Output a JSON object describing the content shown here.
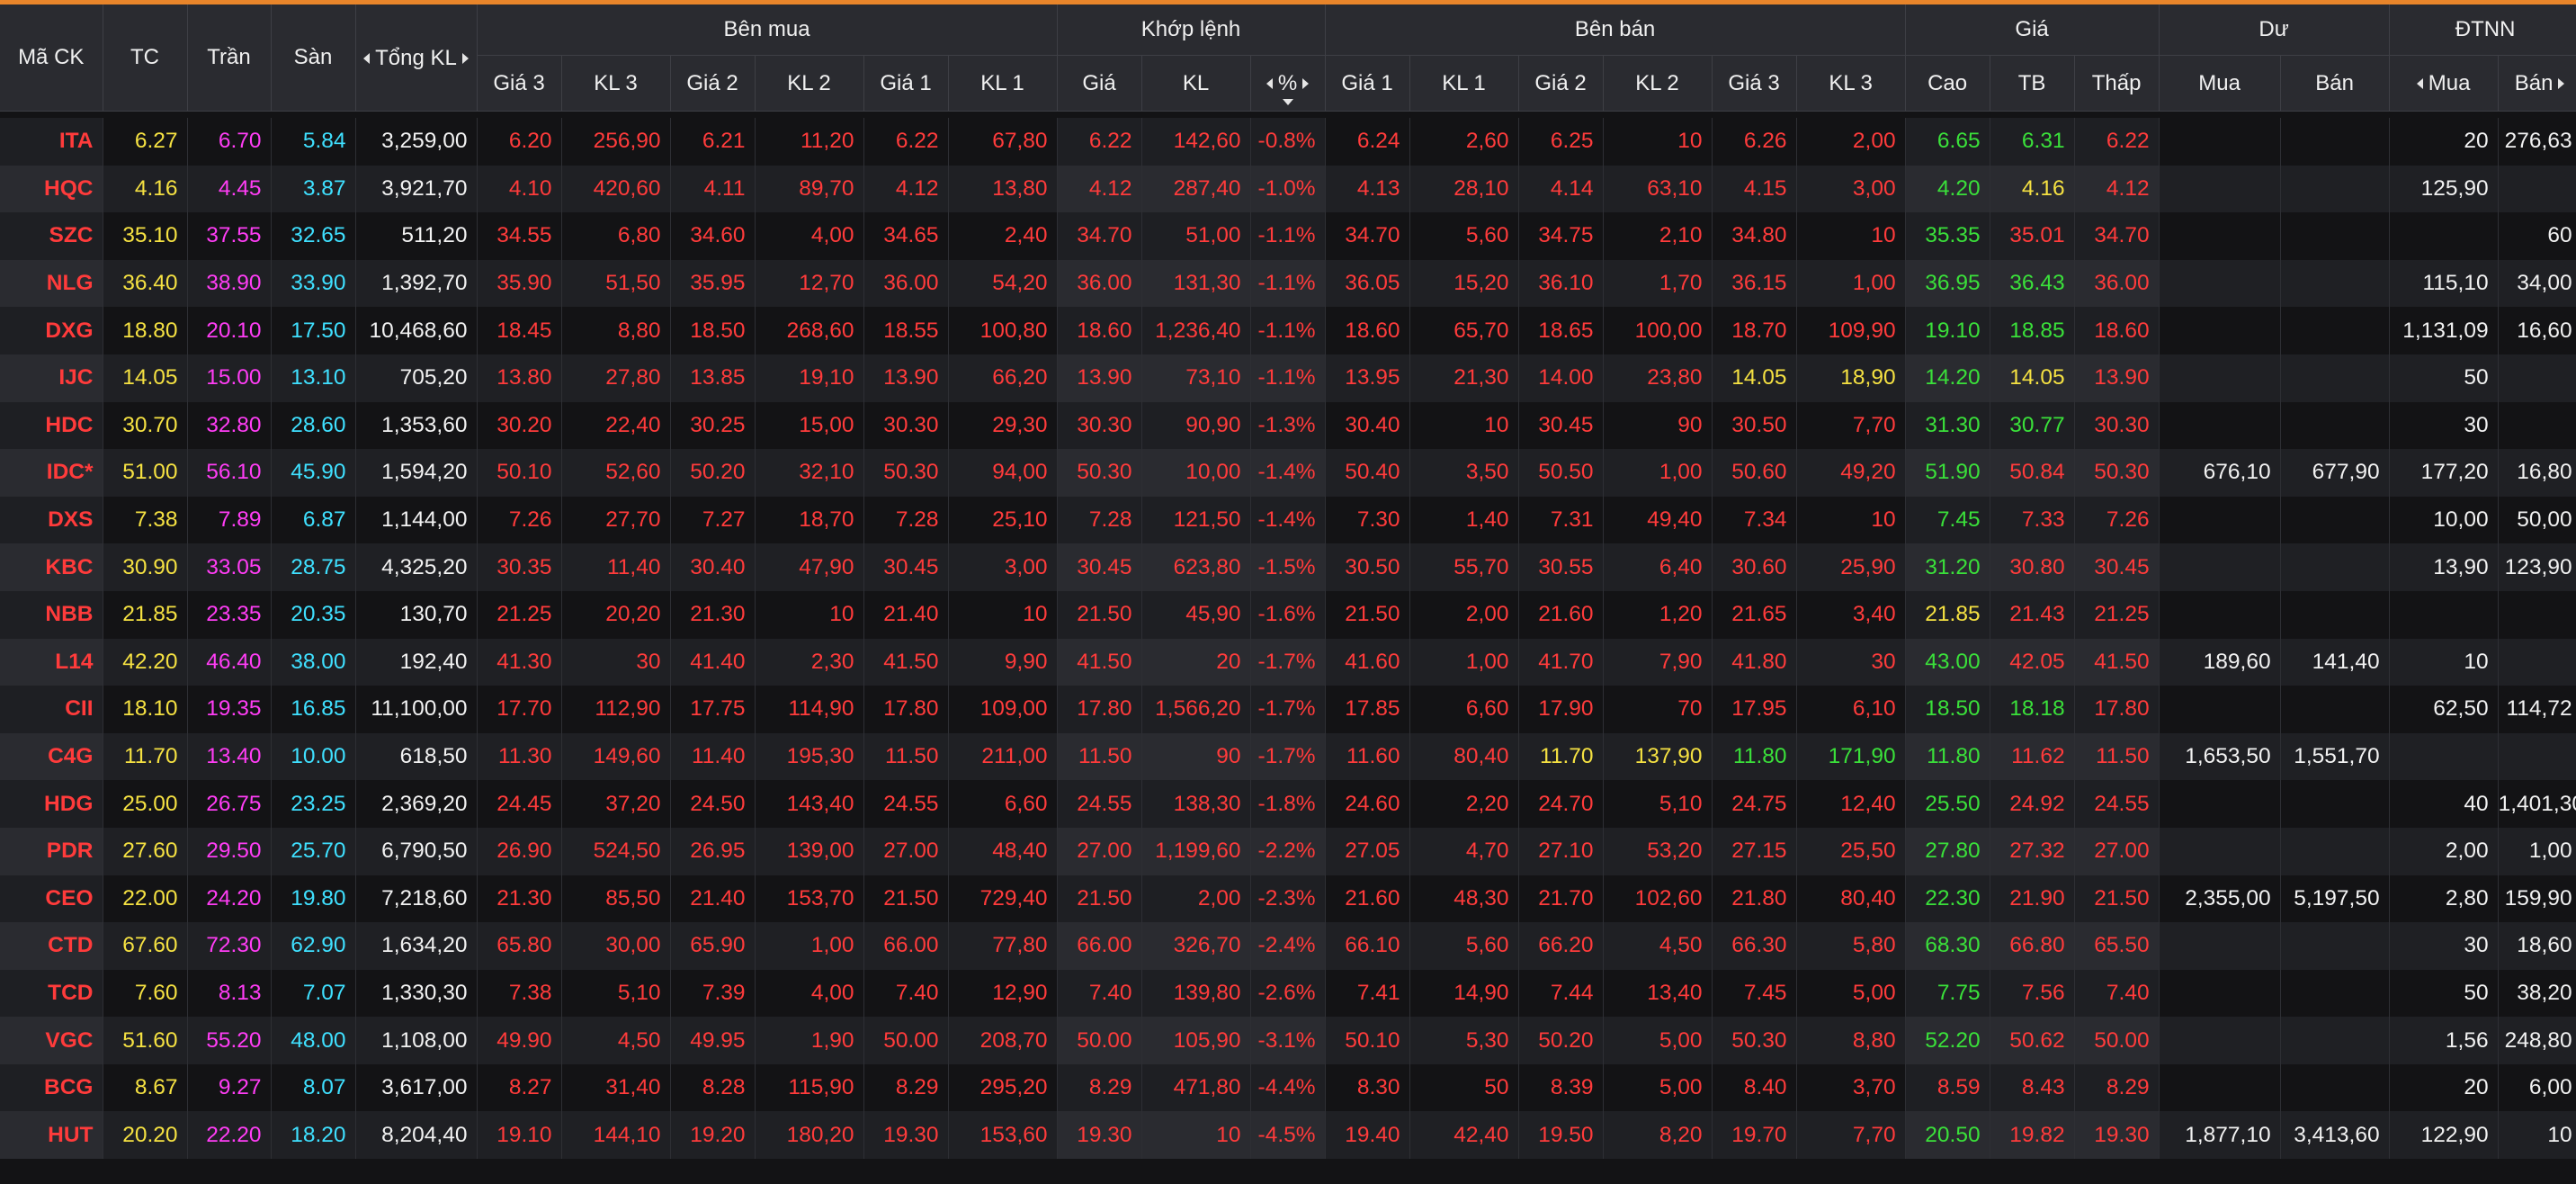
{
  "headers": {
    "symbol": "Mã CK",
    "ref": "TC",
    "ceil": "Trần",
    "floor": "Sàn",
    "total_vol": "Tổng KL",
    "buy_side": "Bên mua",
    "matched": "Khớp lệnh",
    "sell_side": "Bên bán",
    "price": "Giá",
    "surplus": "Dư",
    "foreign": "ĐTNN",
    "buy_sub": [
      "Giá 3",
      "KL 3",
      "Giá 2",
      "KL 2",
      "Giá 1",
      "KL 1"
    ],
    "match_sub": [
      "Giá",
      "KL",
      "%"
    ],
    "sell_sub": [
      "Giá 1",
      "KL 1",
      "Giá 2",
      "KL 2",
      "Giá 3",
      "KL 3"
    ],
    "price_sub": [
      "Cao",
      "TB",
      "Thấp"
    ],
    "surplus_sub": [
      "Mua",
      "Bán"
    ],
    "foreign_sub": [
      "Mua",
      "Bán"
    ]
  },
  "colors": {
    "accent_bar": "#e8852a",
    "red": "#ff3b3b",
    "yellow": "#f5e142",
    "purple": "#ff3df5",
    "cyan": "#3fe0ff",
    "green": "#3ae03a",
    "white": "#f2f2f2"
  },
  "rows": [
    {
      "cells": [
        "ITA",
        "6.27",
        "6.70",
        "5.84",
        "3,259,00",
        "6.20",
        "256,90",
        "6.21",
        "11,20",
        "6.22",
        "67,80",
        "6.22",
        "142,60",
        "-0.8%",
        "6.24",
        "2,60",
        "6.25",
        "10",
        "6.26",
        "2,00",
        "6.65",
        "6.31",
        "6.22",
        "",
        "",
        "20",
        "276,63"
      ],
      "colors": [
        "r",
        "y",
        "p",
        "c",
        "w",
        "r",
        "r",
        "r",
        "r",
        "r",
        "r",
        "r",
        "r",
        "r",
        "r",
        "r",
        "r",
        "r",
        "r",
        "r",
        "g",
        "g",
        "r",
        "w",
        "w",
        "w",
        "w"
      ]
    },
    {
      "cells": [
        "HQC",
        "4.16",
        "4.45",
        "3.87",
        "3,921,70",
        "4.10",
        "420,60",
        "4.11",
        "89,70",
        "4.12",
        "13,80",
        "4.12",
        "287,40",
        "-1.0%",
        "4.13",
        "28,10",
        "4.14",
        "63,10",
        "4.15",
        "3,00",
        "4.20",
        "4.16",
        "4.12",
        "",
        "",
        "125,90",
        ""
      ],
      "colors": [
        "r",
        "y",
        "p",
        "c",
        "w",
        "r",
        "r",
        "r",
        "r",
        "r",
        "r",
        "r",
        "r",
        "r",
        "r",
        "r",
        "r",
        "r",
        "r",
        "r",
        "g",
        "y",
        "r",
        "w",
        "w",
        "w",
        "w"
      ]
    },
    {
      "cells": [
        "SZC",
        "35.10",
        "37.55",
        "32.65",
        "511,20",
        "34.55",
        "6,80",
        "34.60",
        "4,00",
        "34.65",
        "2,40",
        "34.70",
        "51,00",
        "-1.1%",
        "34.70",
        "5,60",
        "34.75",
        "2,10",
        "34.80",
        "10",
        "35.35",
        "35.01",
        "34.70",
        "",
        "",
        "",
        "60"
      ],
      "colors": [
        "r",
        "y",
        "p",
        "c",
        "w",
        "r",
        "r",
        "r",
        "r",
        "r",
        "r",
        "r",
        "r",
        "r",
        "r",
        "r",
        "r",
        "r",
        "r",
        "r",
        "g",
        "r",
        "r",
        "w",
        "w",
        "w",
        "w"
      ]
    },
    {
      "cells": [
        "NLG",
        "36.40",
        "38.90",
        "33.90",
        "1,392,70",
        "35.90",
        "51,50",
        "35.95",
        "12,70",
        "36.00",
        "54,20",
        "36.00",
        "131,30",
        "-1.1%",
        "36.05",
        "15,20",
        "36.10",
        "1,70",
        "36.15",
        "1,00",
        "36.95",
        "36.43",
        "36.00",
        "",
        "",
        "115,10",
        "34,00"
      ],
      "colors": [
        "r",
        "y",
        "p",
        "c",
        "w",
        "r",
        "r",
        "r",
        "r",
        "r",
        "r",
        "r",
        "r",
        "r",
        "r",
        "r",
        "r",
        "r",
        "r",
        "r",
        "g",
        "g",
        "r",
        "w",
        "w",
        "w",
        "w"
      ]
    },
    {
      "cells": [
        "DXG",
        "18.80",
        "20.10",
        "17.50",
        "10,468,60",
        "18.45",
        "8,80",
        "18.50",
        "268,60",
        "18.55",
        "100,80",
        "18.60",
        "1,236,40",
        "-1.1%",
        "18.60",
        "65,70",
        "18.65",
        "100,00",
        "18.70",
        "109,90",
        "19.10",
        "18.85",
        "18.60",
        "",
        "",
        "1,131,09",
        "16,60"
      ],
      "colors": [
        "r",
        "y",
        "p",
        "c",
        "w",
        "r",
        "r",
        "r",
        "r",
        "r",
        "r",
        "r",
        "r",
        "r",
        "r",
        "r",
        "r",
        "r",
        "r",
        "r",
        "g",
        "g",
        "r",
        "w",
        "w",
        "w",
        "w"
      ]
    },
    {
      "cells": [
        "IJC",
        "14.05",
        "15.00",
        "13.10",
        "705,20",
        "13.80",
        "27,80",
        "13.85",
        "19,10",
        "13.90",
        "66,20",
        "13.90",
        "73,10",
        "-1.1%",
        "13.95",
        "21,30",
        "14.00",
        "23,80",
        "14.05",
        "18,90",
        "14.20",
        "14.05",
        "13.90",
        "",
        "",
        "50",
        ""
      ],
      "colors": [
        "r",
        "y",
        "p",
        "c",
        "w",
        "r",
        "r",
        "r",
        "r",
        "r",
        "r",
        "r",
        "r",
        "r",
        "r",
        "r",
        "r",
        "r",
        "y",
        "y",
        "g",
        "y",
        "r",
        "w",
        "w",
        "w",
        "w"
      ]
    },
    {
      "cells": [
        "HDC",
        "30.70",
        "32.80",
        "28.60",
        "1,353,60",
        "30.20",
        "22,40",
        "30.25",
        "15,00",
        "30.30",
        "29,30",
        "30.30",
        "90,90",
        "-1.3%",
        "30.40",
        "10",
        "30.45",
        "90",
        "30.50",
        "7,70",
        "31.30",
        "30.77",
        "30.30",
        "",
        "",
        "30",
        ""
      ],
      "colors": [
        "r",
        "y",
        "p",
        "c",
        "w",
        "r",
        "r",
        "r",
        "r",
        "r",
        "r",
        "r",
        "r",
        "r",
        "r",
        "r",
        "r",
        "r",
        "r",
        "r",
        "g",
        "g",
        "r",
        "w",
        "w",
        "w",
        "w"
      ]
    },
    {
      "cells": [
        "IDC*",
        "51.00",
        "56.10",
        "45.90",
        "1,594,20",
        "50.10",
        "52,60",
        "50.20",
        "32,10",
        "50.30",
        "94,00",
        "50.30",
        "10,00",
        "-1.4%",
        "50.40",
        "3,50",
        "50.50",
        "1,00",
        "50.60",
        "49,20",
        "51.90",
        "50.84",
        "50.30",
        "676,10",
        "677,90",
        "177,20",
        "16,80"
      ],
      "colors": [
        "r",
        "y",
        "p",
        "c",
        "w",
        "r",
        "r",
        "r",
        "r",
        "r",
        "r",
        "r",
        "r",
        "r",
        "r",
        "r",
        "r",
        "r",
        "r",
        "r",
        "g",
        "r",
        "r",
        "w",
        "w",
        "w",
        "w"
      ]
    },
    {
      "cells": [
        "DXS",
        "7.38",
        "7.89",
        "6.87",
        "1,144,00",
        "7.26",
        "27,70",
        "7.27",
        "18,70",
        "7.28",
        "25,10",
        "7.28",
        "121,50",
        "-1.4%",
        "7.30",
        "1,40",
        "7.31",
        "49,40",
        "7.34",
        "10",
        "7.45",
        "7.33",
        "7.26",
        "",
        "",
        "10,00",
        "50,00"
      ],
      "colors": [
        "r",
        "y",
        "p",
        "c",
        "w",
        "r",
        "r",
        "r",
        "r",
        "r",
        "r",
        "r",
        "r",
        "r",
        "r",
        "r",
        "r",
        "r",
        "r",
        "r",
        "g",
        "r",
        "r",
        "w",
        "w",
        "w",
        "w"
      ]
    },
    {
      "cells": [
        "KBC",
        "30.90",
        "33.05",
        "28.75",
        "4,325,20",
        "30.35",
        "11,40",
        "30.40",
        "47,90",
        "30.45",
        "3,00",
        "30.45",
        "623,80",
        "-1.5%",
        "30.50",
        "55,70",
        "30.55",
        "6,40",
        "30.60",
        "25,90",
        "31.20",
        "30.80",
        "30.45",
        "",
        "",
        "13,90",
        "123,90"
      ],
      "colors": [
        "r",
        "y",
        "p",
        "c",
        "w",
        "r",
        "r",
        "r",
        "r",
        "r",
        "r",
        "r",
        "r",
        "r",
        "r",
        "r",
        "r",
        "r",
        "r",
        "r",
        "g",
        "r",
        "r",
        "w",
        "w",
        "w",
        "w"
      ]
    },
    {
      "cells": [
        "NBB",
        "21.85",
        "23.35",
        "20.35",
        "130,70",
        "21.25",
        "20,20",
        "21.30",
        "10",
        "21.40",
        "10",
        "21.50",
        "45,90",
        "-1.6%",
        "21.50",
        "2,00",
        "21.60",
        "1,20",
        "21.65",
        "3,40",
        "21.85",
        "21.43",
        "21.25",
        "",
        "",
        "",
        ""
      ],
      "colors": [
        "r",
        "y",
        "p",
        "c",
        "w",
        "r",
        "r",
        "r",
        "r",
        "r",
        "r",
        "r",
        "r",
        "r",
        "r",
        "r",
        "r",
        "r",
        "r",
        "r",
        "y",
        "r",
        "r",
        "w",
        "w",
        "w",
        "w"
      ]
    },
    {
      "cells": [
        "L14",
        "42.20",
        "46.40",
        "38.00",
        "192,40",
        "41.30",
        "30",
        "41.40",
        "2,30",
        "41.50",
        "9,90",
        "41.50",
        "20",
        "-1.7%",
        "41.60",
        "1,00",
        "41.70",
        "7,90",
        "41.80",
        "30",
        "43.00",
        "42.05",
        "41.50",
        "189,60",
        "141,40",
        "10",
        ""
      ],
      "colors": [
        "r",
        "y",
        "p",
        "c",
        "w",
        "r",
        "r",
        "r",
        "r",
        "r",
        "r",
        "r",
        "r",
        "r",
        "r",
        "r",
        "r",
        "r",
        "r",
        "r",
        "g",
        "r",
        "r",
        "w",
        "w",
        "w",
        "w"
      ]
    },
    {
      "cells": [
        "CII",
        "18.10",
        "19.35",
        "16.85",
        "11,100,00",
        "17.70",
        "112,90",
        "17.75",
        "114,90",
        "17.80",
        "109,00",
        "17.80",
        "1,566,20",
        "-1.7%",
        "17.85",
        "6,60",
        "17.90",
        "70",
        "17.95",
        "6,10",
        "18.50",
        "18.18",
        "17.80",
        "",
        "",
        "62,50",
        "114,72"
      ],
      "colors": [
        "r",
        "y",
        "p",
        "c",
        "w",
        "r",
        "r",
        "r",
        "r",
        "r",
        "r",
        "r",
        "r",
        "r",
        "r",
        "r",
        "r",
        "r",
        "r",
        "r",
        "g",
        "g",
        "r",
        "w",
        "w",
        "w",
        "w"
      ]
    },
    {
      "cells": [
        "C4G",
        "11.70",
        "13.40",
        "10.00",
        "618,50",
        "11.30",
        "149,60",
        "11.40",
        "195,30",
        "11.50",
        "211,00",
        "11.50",
        "90",
        "-1.7%",
        "11.60",
        "80,40",
        "11.70",
        "137,90",
        "11.80",
        "171,90",
        "11.80",
        "11.62",
        "11.50",
        "1,653,50",
        "1,551,70",
        "",
        ""
      ],
      "colors": [
        "r",
        "y",
        "p",
        "c",
        "w",
        "r",
        "r",
        "r",
        "r",
        "r",
        "r",
        "r",
        "r",
        "r",
        "r",
        "r",
        "y",
        "y",
        "g",
        "g",
        "g",
        "r",
        "r",
        "w",
        "w",
        "w",
        "w"
      ]
    },
    {
      "cells": [
        "HDG",
        "25.00",
        "26.75",
        "23.25",
        "2,369,20",
        "24.45",
        "37,20",
        "24.50",
        "143,40",
        "24.55",
        "6,60",
        "24.55",
        "138,30",
        "-1.8%",
        "24.60",
        "2,20",
        "24.70",
        "5,10",
        "24.75",
        "12,40",
        "25.50",
        "24.92",
        "24.55",
        "",
        "",
        "40",
        "1,401,30"
      ],
      "colors": [
        "r",
        "y",
        "p",
        "c",
        "w",
        "r",
        "r",
        "r",
        "r",
        "r",
        "r",
        "r",
        "r",
        "r",
        "r",
        "r",
        "r",
        "r",
        "r",
        "r",
        "g",
        "r",
        "r",
        "w",
        "w",
        "w",
        "w"
      ]
    },
    {
      "cells": [
        "PDR",
        "27.60",
        "29.50",
        "25.70",
        "6,790,50",
        "26.90",
        "524,50",
        "26.95",
        "139,00",
        "27.00",
        "48,40",
        "27.00",
        "1,199,60",
        "-2.2%",
        "27.05",
        "4,70",
        "27.10",
        "53,20",
        "27.15",
        "25,50",
        "27.80",
        "27.32",
        "27.00",
        "",
        "",
        "2,00",
        "1,00"
      ],
      "colors": [
        "r",
        "y",
        "p",
        "c",
        "w",
        "r",
        "r",
        "r",
        "r",
        "r",
        "r",
        "r",
        "r",
        "r",
        "r",
        "r",
        "r",
        "r",
        "r",
        "r",
        "g",
        "r",
        "r",
        "w",
        "w",
        "w",
        "w"
      ]
    },
    {
      "cells": [
        "CEO",
        "22.00",
        "24.20",
        "19.80",
        "7,218,60",
        "21.30",
        "85,50",
        "21.40",
        "153,70",
        "21.50",
        "729,40",
        "21.50",
        "2,00",
        "-2.3%",
        "21.60",
        "48,30",
        "21.70",
        "102,60",
        "21.80",
        "80,40",
        "22.30",
        "21.90",
        "21.50",
        "2,355,00",
        "5,197,50",
        "2,80",
        "159,90"
      ],
      "colors": [
        "r",
        "y",
        "p",
        "c",
        "w",
        "r",
        "r",
        "r",
        "r",
        "r",
        "r",
        "r",
        "r",
        "r",
        "r",
        "r",
        "r",
        "r",
        "r",
        "r",
        "g",
        "r",
        "r",
        "w",
        "w",
        "w",
        "w"
      ]
    },
    {
      "cells": [
        "CTD",
        "67.60",
        "72.30",
        "62.90",
        "1,634,20",
        "65.80",
        "30,00",
        "65.90",
        "1,00",
        "66.00",
        "77,80",
        "66.00",
        "326,70",
        "-2.4%",
        "66.10",
        "5,60",
        "66.20",
        "4,50",
        "66.30",
        "5,80",
        "68.30",
        "66.80",
        "65.50",
        "",
        "",
        "30",
        "18,60"
      ],
      "colors": [
        "r",
        "y",
        "p",
        "c",
        "w",
        "r",
        "r",
        "r",
        "r",
        "r",
        "r",
        "r",
        "r",
        "r",
        "r",
        "r",
        "r",
        "r",
        "r",
        "r",
        "g",
        "r",
        "r",
        "w",
        "w",
        "w",
        "w"
      ]
    },
    {
      "cells": [
        "TCD",
        "7.60",
        "8.13",
        "7.07",
        "1,330,30",
        "7.38",
        "5,10",
        "7.39",
        "4,00",
        "7.40",
        "12,90",
        "7.40",
        "139,80",
        "-2.6%",
        "7.41",
        "14,90",
        "7.44",
        "13,40",
        "7.45",
        "5,00",
        "7.75",
        "7.56",
        "7.40",
        "",
        "",
        "50",
        "38,20"
      ],
      "colors": [
        "r",
        "y",
        "p",
        "c",
        "w",
        "r",
        "r",
        "r",
        "r",
        "r",
        "r",
        "r",
        "r",
        "r",
        "r",
        "r",
        "r",
        "r",
        "r",
        "r",
        "g",
        "r",
        "r",
        "w",
        "w",
        "w",
        "w"
      ]
    },
    {
      "cells": [
        "VGC",
        "51.60",
        "55.20",
        "48.00",
        "1,108,00",
        "49.90",
        "4,50",
        "49.95",
        "1,90",
        "50.00",
        "208,70",
        "50.00",
        "105,90",
        "-3.1%",
        "50.10",
        "5,30",
        "50.20",
        "5,00",
        "50.30",
        "8,80",
        "52.20",
        "50.62",
        "50.00",
        "",
        "",
        "1,56",
        "248,80"
      ],
      "colors": [
        "r",
        "y",
        "p",
        "c",
        "w",
        "r",
        "r",
        "r",
        "r",
        "r",
        "r",
        "r",
        "r",
        "r",
        "r",
        "r",
        "r",
        "r",
        "r",
        "r",
        "g",
        "r",
        "r",
        "w",
        "w",
        "w",
        "w"
      ]
    },
    {
      "cells": [
        "BCG",
        "8.67",
        "9.27",
        "8.07",
        "3,617,00",
        "8.27",
        "31,40",
        "8.28",
        "115,90",
        "8.29",
        "295,20",
        "8.29",
        "471,80",
        "-4.4%",
        "8.30",
        "50",
        "8.39",
        "5,00",
        "8.40",
        "3,70",
        "8.59",
        "8.43",
        "8.29",
        "",
        "",
        "20",
        "6,00"
      ],
      "colors": [
        "r",
        "y",
        "p",
        "c",
        "w",
        "r",
        "r",
        "r",
        "r",
        "r",
        "r",
        "r",
        "r",
        "r",
        "r",
        "r",
        "r",
        "r",
        "r",
        "r",
        "r",
        "r",
        "r",
        "w",
        "w",
        "w",
        "w"
      ]
    },
    {
      "cells": [
        "HUT",
        "20.20",
        "22.20",
        "18.20",
        "8,204,40",
        "19.10",
        "144,10",
        "19.20",
        "180,20",
        "19.30",
        "153,60",
        "19.30",
        "10",
        "-4.5%",
        "19.40",
        "42,40",
        "19.50",
        "8,20",
        "19.70",
        "7,70",
        "20.50",
        "19.82",
        "19.30",
        "1,877,10",
        "3,413,60",
        "122,90",
        "10"
      ],
      "colors": [
        "r",
        "y",
        "p",
        "c",
        "w",
        "r",
        "r",
        "r",
        "r",
        "r",
        "r",
        "r",
        "r",
        "r",
        "r",
        "r",
        "r",
        "r",
        "r",
        "r",
        "g",
        "r",
        "r",
        "w",
        "w",
        "w",
        "w"
      ]
    }
  ]
}
